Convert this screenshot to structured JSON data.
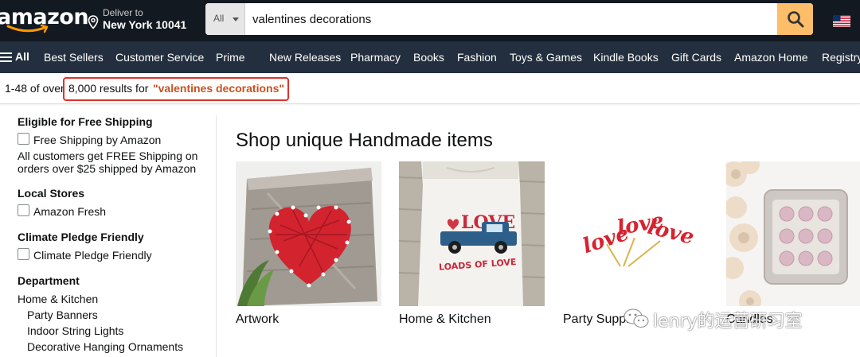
{
  "header": {
    "logo_text": "amazon",
    "deliver_label": "Deliver to",
    "deliver_location": "New York 10041",
    "search_category": "All",
    "search_value": "valentines decorations",
    "icons": [
      "location-pin-icon",
      "search-icon",
      "us-flag-icon"
    ]
  },
  "nav": {
    "all_label": "All",
    "items": [
      "Best Sellers",
      "Customer Service",
      "Prime",
      "New Releases",
      "Pharmacy",
      "Books",
      "Fashion",
      "Toys & Games",
      "Kindle Books",
      "Gift Cards",
      "Amazon Home",
      "Registry"
    ]
  },
  "results": {
    "prefix": "1-48 of over",
    "count_text": "8,000 results for",
    "query": "\"valentines decorations\""
  },
  "sidebar": {
    "free_shipping": {
      "heading": "Eligible for Free Shipping",
      "option": "Free Shipping by Amazon",
      "note_line1": "All customers get FREE Shipping on",
      "note_line2": "orders over $25 shipped by Amazon"
    },
    "local_stores": {
      "heading": "Local Stores",
      "option": "Amazon Fresh"
    },
    "climate": {
      "heading": "Climate Pledge Friendly",
      "option": "Climate Pledge Friendly"
    },
    "department": {
      "heading": "Department",
      "top": "Home & Kitchen",
      "sub": [
        "Party Banners",
        "Indoor String Lights",
        "Decorative Hanging Ornaments"
      ]
    }
  },
  "main": {
    "title": "Shop unique Handmade items",
    "cards": [
      {
        "label": "Artwork"
      },
      {
        "label": "Home & Kitchen"
      },
      {
        "label": "Party Supplies"
      },
      {
        "label": "Candles"
      }
    ],
    "towel_text": "LOADS OF LOVE",
    "topper_text": "love"
  },
  "watermark": {
    "text": "lenry的运营研习室"
  },
  "colors": {
    "header_bg": "#131921",
    "nav_bg": "#232f3e",
    "search_button": "#febd69",
    "query_accent": "#c7511f",
    "highlight_border": "#e0322a"
  }
}
